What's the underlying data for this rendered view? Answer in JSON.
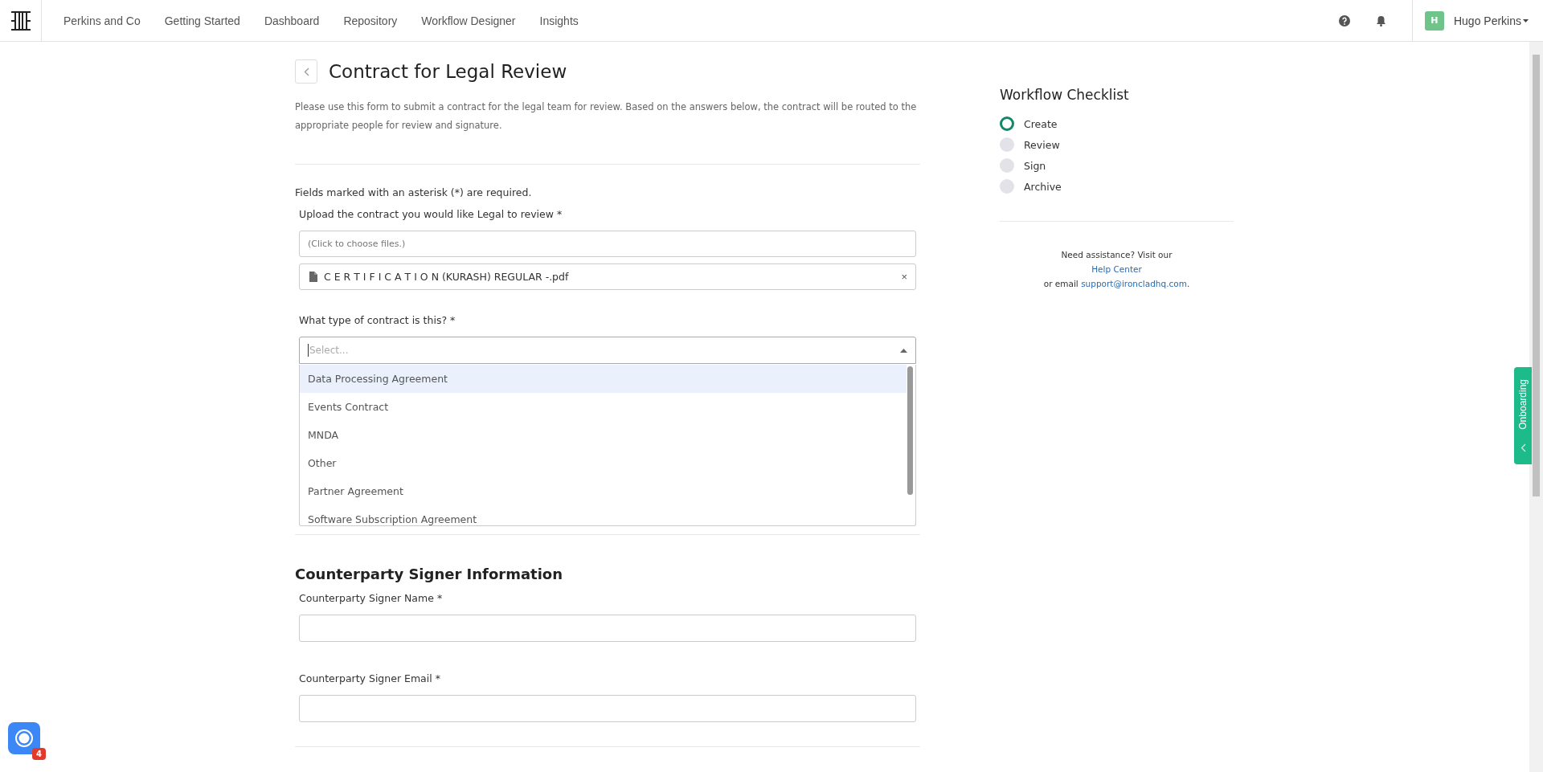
{
  "nav": {
    "items": [
      {
        "label": "Perkins and Co"
      },
      {
        "label": "Getting Started"
      },
      {
        "label": "Dashboard"
      },
      {
        "label": "Repository"
      },
      {
        "label": "Workflow Designer"
      },
      {
        "label": "Insights"
      }
    ],
    "user": {
      "initial": "H",
      "name": "Hugo Perkins"
    }
  },
  "form": {
    "title": "Contract for Legal Review",
    "description": "Please use this form to submit a contract for the legal team for review. Based on the answers below, the contract will be routed to the appropriate people for review and signature.",
    "required_note": "Fields marked with an asterisk (*) are required.",
    "upload": {
      "label": "Upload the contract you would like Legal to review *",
      "placeholder": "(Click to choose files.)",
      "files": [
        {
          "name": "C E R T I F I C A T I O N (KURASH) REGULAR -.pdf",
          "remove": "×"
        }
      ]
    },
    "contract_type": {
      "label": "What type of contract is this? *",
      "placeholder": "Select...",
      "expanded": true,
      "options": [
        {
          "label": "Data Processing Agreement",
          "selected": true
        },
        {
          "label": "Events Contract",
          "selected": false
        },
        {
          "label": "MNDA",
          "selected": false
        },
        {
          "label": "Other",
          "selected": false
        },
        {
          "label": "Partner Agreement",
          "selected": false
        },
        {
          "label": "Software Subscription Agreement",
          "selected": false
        }
      ]
    },
    "sections": [
      {
        "heading": "Counterparty Signer Information",
        "fields": [
          {
            "label": "Counterparty Signer Name *"
          },
          {
            "label": "Counterparty Signer Email *"
          }
        ]
      }
    ]
  },
  "checklist": {
    "title": "Workflow Checklist",
    "steps": [
      {
        "label": "Create",
        "current": true
      },
      {
        "label": "Review",
        "current": false
      },
      {
        "label": "Sign",
        "current": false
      },
      {
        "label": "Archive",
        "current": false
      }
    ],
    "help_line": "Need assistance? Visit our",
    "help_link": "Help Center",
    "email_prefix": "or email",
    "email_link": "support@ironcladhq.com",
    "email_suffix": "."
  },
  "onboarding_tab": {
    "label": "Onboarding"
  },
  "launcher": {
    "badge": "4"
  }
}
